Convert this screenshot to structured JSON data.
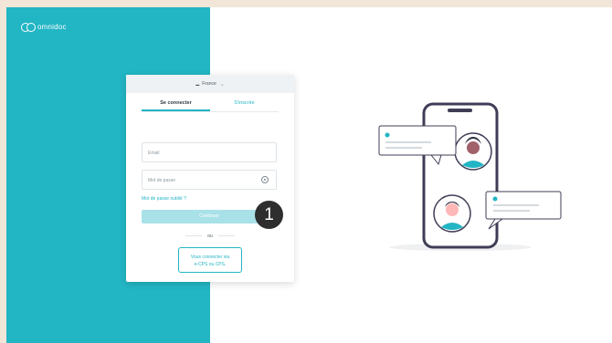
{
  "brand": {
    "name": "omnidoc",
    "accent": "#22b5c4"
  },
  "card": {
    "country": "France",
    "country_icon": "flag-icon",
    "tabs": [
      {
        "label": "Se connecter",
        "active": true
      },
      {
        "label": "S'inscrire",
        "active": false
      }
    ],
    "email_placeholder": "Email",
    "password_placeholder": "Mot de passe",
    "forgot_link": "Mot de passe oublié ?",
    "continue_label": "Continuer",
    "separator": "ou",
    "ecps_button_line1": "Vous connecter via",
    "ecps_button_line2": "e-CPS ou CPS."
  },
  "annotation": {
    "step_number": "1"
  }
}
